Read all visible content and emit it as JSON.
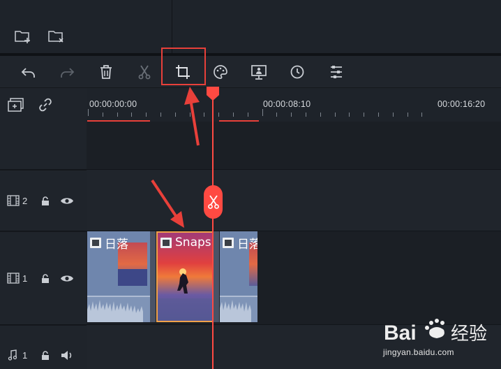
{
  "media_panel": {
    "buttons": [
      {
        "name": "new-folder-icon"
      },
      {
        "name": "delete-folder-icon"
      }
    ]
  },
  "toolbar": {
    "tools": [
      {
        "name": "undo-icon"
      },
      {
        "name": "redo-icon"
      },
      {
        "name": "delete-icon"
      },
      {
        "name": "split-icon"
      },
      {
        "name": "crop-icon"
      },
      {
        "name": "color-palette-icon"
      },
      {
        "name": "presentation-icon"
      },
      {
        "name": "speed-clock-icon"
      },
      {
        "name": "adjust-sliders-icon"
      }
    ],
    "highlighted_tool": "crop-icon"
  },
  "ruler": {
    "timecodes": [
      "00:00:00:00",
      "00:00:08:10",
      "00:00:16:20"
    ]
  },
  "tracks": [
    {
      "kind": "video",
      "number": "2"
    },
    {
      "kind": "video",
      "number": "1"
    },
    {
      "kind": "audio",
      "number": "1"
    }
  ],
  "clips": [
    {
      "label": "日落",
      "selected": false
    },
    {
      "label": "Snapsh",
      "selected": true
    },
    {
      "label": "日落",
      "selected": false
    }
  ],
  "colors": {
    "accent_red": "#ff4a42",
    "selected_clip_border": "#f0a24a"
  },
  "watermark": {
    "brand": "Bai 经验",
    "url": "jingyan.baidu.com"
  }
}
